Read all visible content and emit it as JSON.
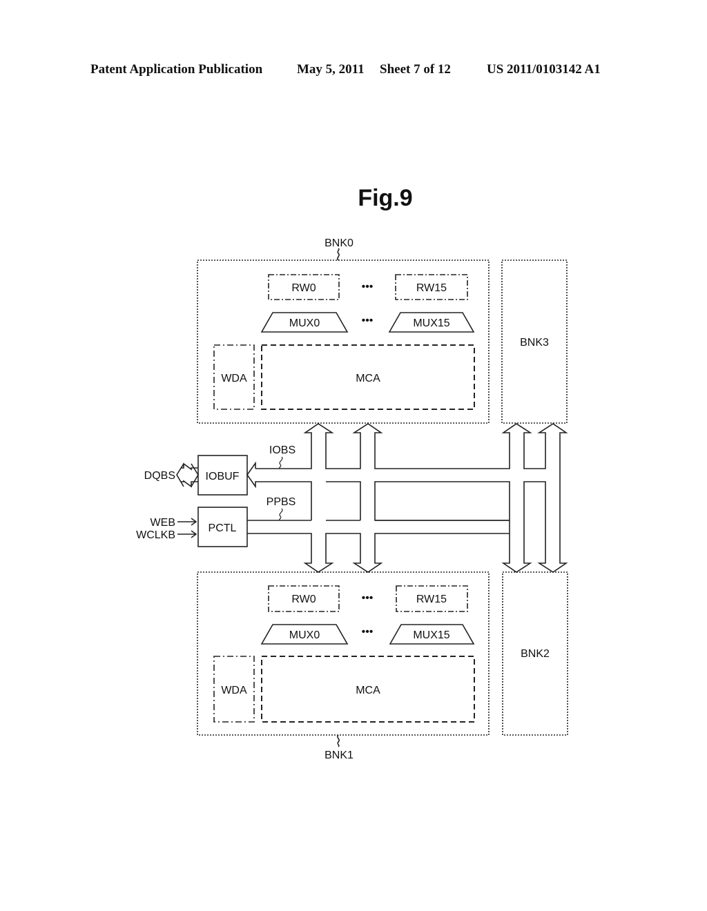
{
  "header": {
    "publication": "Patent Application Publication",
    "date": "May 5, 2011",
    "sheet": "Sheet 7 of 12",
    "number": "US 2011/0103142 A1"
  },
  "figure": {
    "title": "Fig.9",
    "banks": {
      "bnk0": {
        "label": "BNK0",
        "rw_first": "RW0",
        "rw_last": "RW15",
        "mux_first": "MUX0",
        "mux_last": "MUX15",
        "wda": "WDA",
        "mca": "MCA"
      },
      "bnk1": {
        "label": "BNK1",
        "rw_first": "RW0",
        "rw_last": "RW15",
        "mux_first": "MUX0",
        "mux_last": "MUX15",
        "wda": "WDA",
        "mca": "MCA"
      },
      "bnk2": {
        "label": "BNK2"
      },
      "bnk3": {
        "label": "BNK3"
      }
    },
    "blocks": {
      "iobuf": "IOBUF",
      "pctl": "PCTL"
    },
    "buses": {
      "iobs": "IOBS",
      "ppbs": "PPBS"
    },
    "signals": {
      "dqbs": "DQBS",
      "web": "WEB",
      "wclkb": "WCLKB"
    },
    "ellipsis": "•••"
  }
}
